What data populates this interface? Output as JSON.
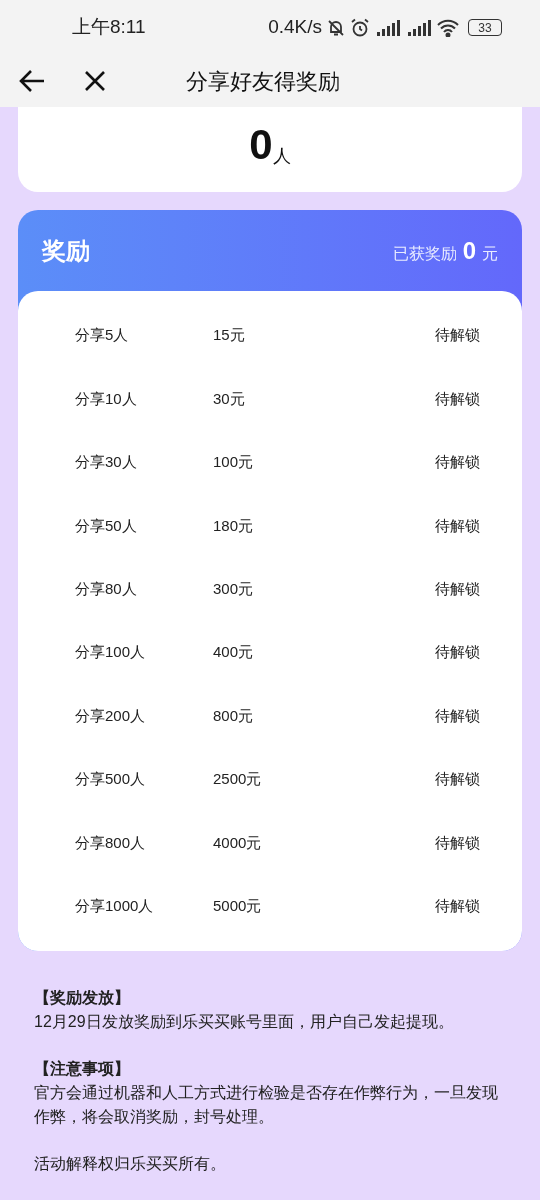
{
  "status_bar": {
    "time": "上午8:11",
    "speed": "0.4K/s",
    "battery": "33"
  },
  "nav": {
    "title": "分享好友得奖励"
  },
  "share_count": {
    "value": "0",
    "unit": "人"
  },
  "rewards": {
    "title": "奖励",
    "earned_label": "已获奖励",
    "earned_value": "0",
    "earned_unit": "元",
    "rows": [
      {
        "target": "分享5人",
        "amount": "15元",
        "status": "待解锁"
      },
      {
        "target": "分享10人",
        "amount": "30元",
        "status": "待解锁"
      },
      {
        "target": "分享30人",
        "amount": "100元",
        "status": "待解锁"
      },
      {
        "target": "分享50人",
        "amount": "180元",
        "status": "待解锁"
      },
      {
        "target": "分享80人",
        "amount": "300元",
        "status": "待解锁"
      },
      {
        "target": "分享100人",
        "amount": "400元",
        "status": "待解锁"
      },
      {
        "target": "分享200人",
        "amount": "800元",
        "status": "待解锁"
      },
      {
        "target": "分享500人",
        "amount": "2500元",
        "status": "待解锁"
      },
      {
        "target": "分享800人",
        "amount": "4000元",
        "status": "待解锁"
      },
      {
        "target": "分享1000人",
        "amount": "5000元",
        "status": "待解锁"
      }
    ]
  },
  "notes": [
    {
      "heading": "【奖励发放】",
      "body": "12月29日发放奖励到乐买买账号里面，用户自己发起提现。"
    },
    {
      "heading": "【注意事项】",
      "body": "官方会通过机器和人工方式进行检验是否存在作弊行为，一旦发现作弊，将会取消奖励，封号处理。"
    },
    {
      "body": "活动解释权归乐买买所有。"
    }
  ]
}
